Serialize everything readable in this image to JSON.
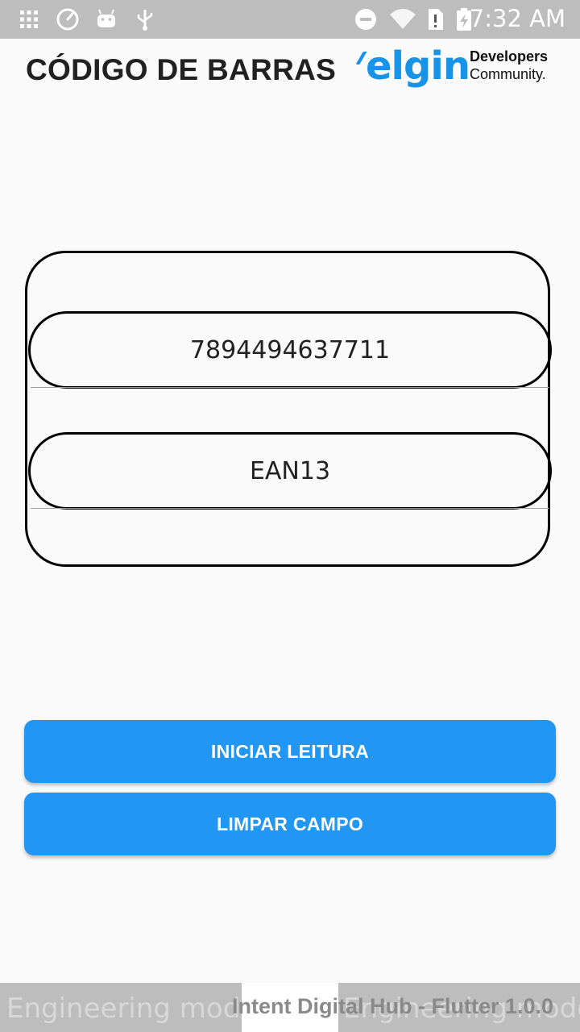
{
  "status_bar": {
    "time": "7:32 AM",
    "left_icons": [
      "apps-grid-icon",
      "speedometer-icon",
      "android-icon",
      "usb-icon"
    ],
    "right_icons": [
      "do-not-disturb-icon",
      "wifi-icon",
      "sim-alert-icon",
      "battery-charging-icon"
    ],
    "color": "#bdbdbd"
  },
  "header": {
    "title": "CÓDIGO DE BARRAS",
    "logo": {
      "brand": "elgin",
      "line1": "Developers",
      "line2": "Community."
    }
  },
  "form": {
    "barcode_value": "7894494637711",
    "barcode_type": "EAN13"
  },
  "buttons": {
    "start_reading": "INICIAR LEITURA",
    "clear_field": "LIMPAR CAMPO"
  },
  "bottom": {
    "left_watermark": "Engineering mode",
    "right_watermark": "Engineering mode",
    "app_version": "Intent Digital Hub - Flutter 1.0.0"
  },
  "colors": {
    "accent": "#2196f3",
    "brand": "#1793e8",
    "background": "#fafafa"
  }
}
